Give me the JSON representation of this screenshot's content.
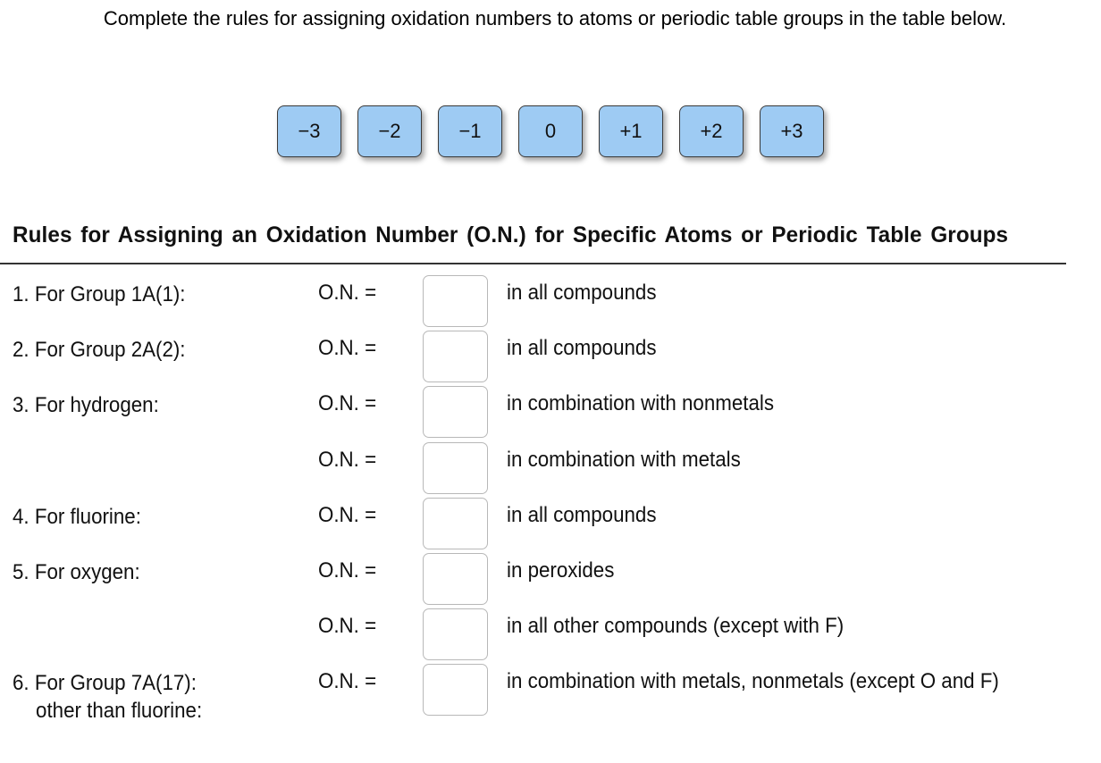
{
  "instruction": "Complete the rules for assigning oxidation numbers to atoms or periodic table groups in the table below.",
  "tiles": [
    "−3",
    "−2",
    "−1",
    "0",
    "+1",
    "+2",
    "+3"
  ],
  "tile_color": "#9ecbf3",
  "table": {
    "title": "Rules for Assigning an Oxidation Number (O.N.) for Specific Atoms or Periodic Table Groups",
    "rows": [
      {
        "rule": "1. For Group 1A(1):",
        "rule_line2": "",
        "on_label": "O.N. =",
        "answer": "",
        "condition": "in all compounds"
      },
      {
        "rule": "2. For Group 2A(2):",
        "rule_line2": "",
        "on_label": "O.N. =",
        "answer": "",
        "condition": "in all compounds"
      },
      {
        "rule": "3. For hydrogen:",
        "rule_line2": "",
        "on_label": "O.N. =",
        "answer": "",
        "condition": "in combination with nonmetals"
      },
      {
        "rule": "",
        "rule_line2": "",
        "on_label": "O.N. =",
        "answer": "",
        "condition": "in combination with metals"
      },
      {
        "rule": "4. For fluorine:",
        "rule_line2": "",
        "on_label": "O.N. =",
        "answer": "",
        "condition": "in all compounds"
      },
      {
        "rule": "5. For oxygen:",
        "rule_line2": "",
        "on_label": "O.N. =",
        "answer": "",
        "condition": "in peroxides"
      },
      {
        "rule": "",
        "rule_line2": "",
        "on_label": "O.N. =",
        "answer": "",
        "condition": "in all other compounds (except with F)"
      },
      {
        "rule": "6. For Group 7A(17):",
        "rule_line2": "other than fluorine:",
        "on_label": "O.N. =",
        "answer": "",
        "condition": "in combination with metals, nonmetals (except O and F)"
      }
    ]
  }
}
